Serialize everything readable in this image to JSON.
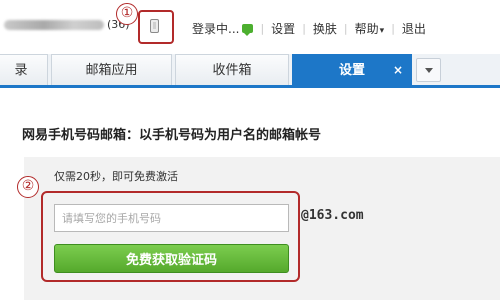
{
  "header": {
    "unread_count": "(36)",
    "nav": {
      "login_status": "登录中...",
      "settings": "设置",
      "skin": "换肤",
      "help": "帮助",
      "help_caret": "▾",
      "logout": "退出",
      "separator": "|"
    },
    "icons": [
      "phone-icon",
      "chat-icon",
      "chevron-down-icon"
    ]
  },
  "annotations": {
    "marker_1": "①",
    "marker_2": "②"
  },
  "tabs": [
    {
      "label": "录"
    },
    {
      "label": "邮箱应用"
    },
    {
      "label": "收件箱"
    },
    {
      "label": "设置",
      "active": true,
      "close": "×"
    }
  ],
  "main": {
    "heading": "网易手机号码邮箱：以手机号码为用户名的邮箱帐号",
    "note": "仅需20秒，即可免费激活",
    "phone_placeholder": "请填写您的手机号码",
    "phone_value": "",
    "domain": "@163.com",
    "get_code_button": "免费获取验证码"
  },
  "colors": {
    "accent": "#1d77c8",
    "annotation": "#b22a2a",
    "button_green": "#5cb135"
  }
}
